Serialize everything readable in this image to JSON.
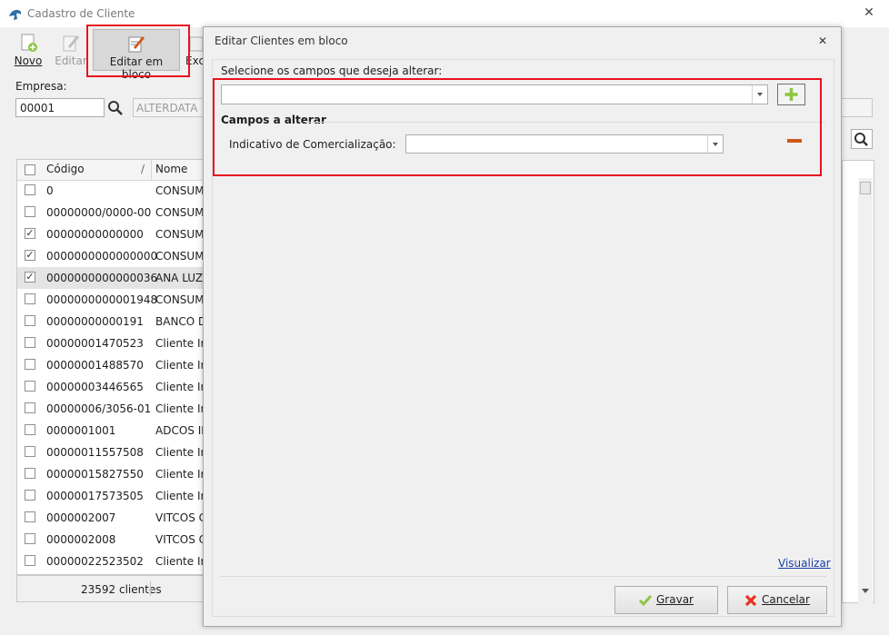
{
  "window": {
    "title": "Cadastro de Cliente"
  },
  "toolbar": {
    "novo": "Novo",
    "editar": "Editar",
    "editar_bloco": "Editar em bloco",
    "excluir": "Exc"
  },
  "empresa": {
    "label": "Empresa:",
    "code": "00001",
    "name": "ALTERDATA"
  },
  "grid": {
    "columns": [
      "Código",
      "Nome"
    ],
    "rows": [
      {
        "checked": false,
        "code": "0",
        "name": "CONSUM"
      },
      {
        "checked": false,
        "code": "00000000/0000-00",
        "name": "CONSUM"
      },
      {
        "checked": true,
        "code": "00000000000000",
        "name": "CONSUM"
      },
      {
        "checked": true,
        "code": "0000000000000000",
        "name": "CONSUM"
      },
      {
        "checked": true,
        "code": "0000000000000036",
        "name": "ANA LUZI"
      },
      {
        "checked": false,
        "code": "0000000000001948",
        "name": "CONSUM"
      },
      {
        "checked": false,
        "code": "00000000000191",
        "name": "BANCO D"
      },
      {
        "checked": false,
        "code": "00000001470523",
        "name": "Cliente Im"
      },
      {
        "checked": false,
        "code": "00000001488570",
        "name": "Cliente Im"
      },
      {
        "checked": false,
        "code": "00000003446565",
        "name": "Cliente Im"
      },
      {
        "checked": false,
        "code": "00000006/3056-01",
        "name": "Cliente Im"
      },
      {
        "checked": false,
        "code": "0000001001",
        "name": "ADCOS IN"
      },
      {
        "checked": false,
        "code": "00000011557508",
        "name": "Cliente Im"
      },
      {
        "checked": false,
        "code": "00000015827550",
        "name": "Cliente Im"
      },
      {
        "checked": false,
        "code": "00000017573505",
        "name": "Cliente Im"
      },
      {
        "checked": false,
        "code": "0000002007",
        "name": "VITCOS C"
      },
      {
        "checked": false,
        "code": "0000002008",
        "name": "VITCOS C"
      },
      {
        "checked": false,
        "code": "00000022523502",
        "name": "Cliente Im"
      }
    ],
    "count": "23592 clientes"
  },
  "dialog": {
    "title": "Editar Clientes em bloco",
    "select_label": "Selecione os campos que deseja alterar:",
    "select_value": "",
    "campos_label": "Campos a alterar",
    "field_label": "Indicativo de Comercialização:",
    "field_value": "",
    "visualizar": "Visualizar",
    "gravar": "Gravar",
    "cancelar": "Cancelar"
  },
  "colors": {
    "highlight": "#e8131e",
    "add": "#8cc63f",
    "remove": "#d0581a",
    "link": "#1a3ea8"
  }
}
